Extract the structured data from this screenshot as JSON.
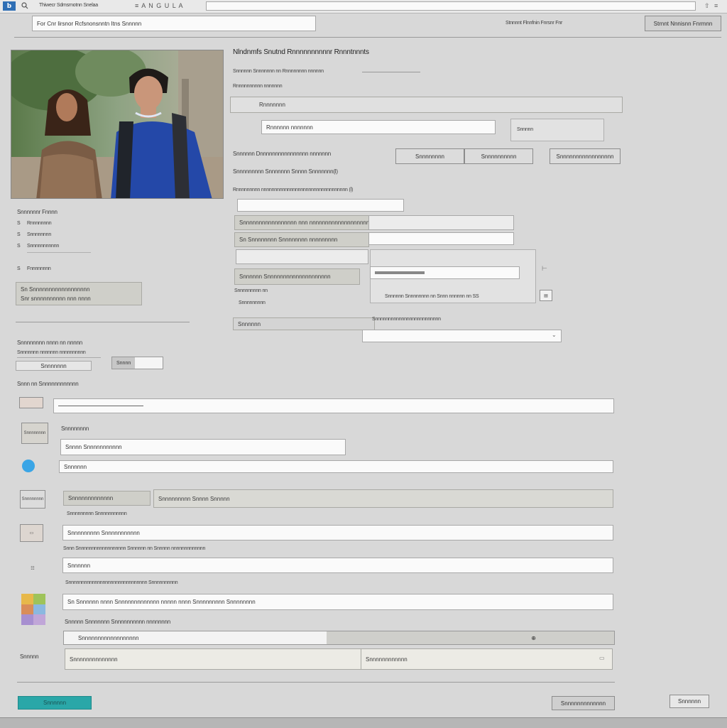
{
  "toolbar": {
    "app_icon": "app-logo-icon",
    "search_icon": "search-icon",
    "title": "Thiwecr Sdmsrnotnn Snelaa",
    "menu_letters": "≡ A N G U L A",
    "address_value": ""
  },
  "header": {
    "breadcrumb": "For Cnr lirsnor  Rcfsnonsnntn     Itns Snnnnn",
    "status": "Stnnnnt Flnnfnin  Fnrsnr  Fnr",
    "register_button": "Strnnt  Nnnisnn Fnrmnn"
  },
  "profile": {
    "photo_alt": "Two students with backpacks outdoors",
    "caption": "Snnnnnnr Fnnnn",
    "stats": [
      {
        "mark": "S",
        "label": "Rnnnnnnnn"
      },
      {
        "mark": "S",
        "label": "Snnnnnnnn"
      },
      {
        "mark": "S",
        "label": "Snnnnnnnnnnn"
      },
      {
        "mark": "S",
        "label": "Fnnnnnnnn"
      }
    ],
    "notice_line1": "Sn Snnnnnnnnnnnnnnnnnn",
    "notice_line2": "Snr snnnnnnnnnn nnn nnnn"
  },
  "form_main": {
    "heading": "Nlndnmfs  Snutnd  Rnnnnnnnnnnr  Rnnntnnnts",
    "sub1": "Snnnnnn Snnnnnnn nn Rnnnnnnnn nnnnnn",
    "sub2": "Rnnnnnnnnnn  nnnnnnn",
    "bar_label": "Rnnnnnnn",
    "name_input": "Rnnnnnn nnnnnnn",
    "name_side_label": "Snnnnn",
    "section_label": "Snnnnnn Dnnnnnnnnnnnnnnnn nnnnnnn",
    "btn_a": "Snnnnnnnn",
    "btn_b": "Snnnnnnnnnn",
    "btn_c": "Snnnnnnnnnnnnnnnnn",
    "line_a": "Snnnnnnnnn  Snnnnnnn  Snnnn  Snnnnnnn(l)",
    "line_b": "Rnnnnnnnnn nnnnnnnnnnnnnnnnnnnnnnnnnnnnnnnnn (l)",
    "rows": [
      "Snnnnnnnnnnnnnnnnn nnn nnnnnnnnnnnnnnnnnnnnnnnn",
      "Sn Snnnnnnnn  Snnnnnnnn nnnnnnnnn",
      "",
      "Snnnnnn Snnnnnnnnnnnnnnnnnnnn"
    ],
    "sub_note_label": "Snnnnnnnnn nn",
    "sub_note": "Snnnnnnnnn",
    "side_note": "Snnnnnn  Snnnnnnnn  nn  Snnn nnnnnn nn SS",
    "dropdown_label": "Snnnnnn",
    "dropdown_caption": "Snnnnnnnnnnnnnnnnnnnnnnnnn",
    "dropdown_value": ""
  },
  "secondary": {
    "heading": "Snnnnnnnn nnnn nn nnnnn",
    "subheading": "Snnnnnnn nnnnnnn nnnnnnnnnn",
    "small_field": "Snnnnnnn",
    "toggle_value": "Snnnn"
  },
  "details": {
    "heading": "Snnn nn Snnnnnnnnnnnn",
    "rows": [
      {
        "icon": "document-icon",
        "label": "",
        "value": ""
      },
      {
        "icon": "user-card-icon",
        "label": "Snnnnnnnn",
        "value": "Snnnn  Snnnnnnnnnnn"
      },
      {
        "icon": "globe-icon",
        "label": "",
        "value": "Snnnnnn"
      },
      {
        "icon": "calendar-icon",
        "label": "Snnnnnnnn",
        "value": "Snnnnnnnnnnnnn"
      },
      {
        "icon": "id-card-icon",
        "label": "Snnnnnnnnn Snnnn Snnnnn",
        "value": "Snnnnnnnnn Snnnnnnnnnnn"
      },
      {
        "icon": "clipboard-icon",
        "label": "Snnn Snnnnnnnnnnnnnnnnnn   Snnnnnn  nn Snnnnn nnnnnnnnnnnnn",
        "value": "Snnnnnn"
      },
      {
        "icon": "palette-icon",
        "label": "Snnnnnnnnnnnnnnnnnnnnnnnnnnnnnn Snnnnnnnnnn",
        "value": "Sn Snnnnnn nnnn Snnnnnnnnnnnnn nnnnn  nnnn  Snnnnnnnnn Snnnnnnnn"
      }
    ],
    "adv_label": "Snnnnn  Snnnnnnn  Snnnnnnnnnn nnnnnnnn",
    "adv_value": "Snnnnnnnnnnnnnnnnnn",
    "footer_label": "Snnnnn",
    "footer_left": "Snnnnnnnnnnnnnn",
    "footer_right": "Snnnnnnnnnnnn"
  },
  "actions": {
    "submit": "Snnnnnn",
    "cancel": "Snnnnnnnnnnnnn",
    "help": "Snnnnnn"
  },
  "colors": {
    "accent": "#2aa7a8",
    "background": "#d8d8d8"
  }
}
